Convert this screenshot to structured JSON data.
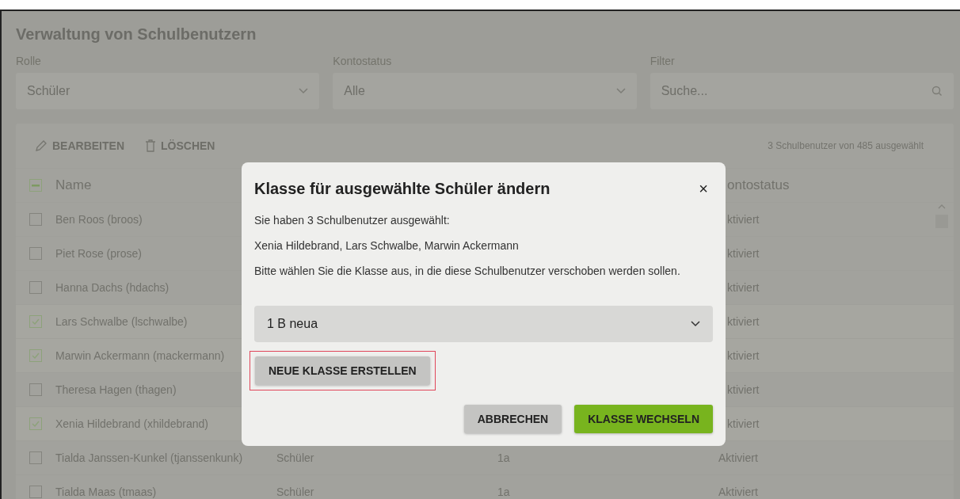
{
  "page": {
    "title": "Verwaltung von Schulbenutzern"
  },
  "filters": [
    {
      "kind": "select",
      "label": "Rolle",
      "value": "Schüler"
    },
    {
      "kind": "select",
      "label": "Kontostatus",
      "value": "Alle"
    },
    {
      "kind": "search",
      "label": "Filter",
      "placeholder": "Suche..."
    }
  ],
  "toolbar": {
    "actions": [
      {
        "kind": "edit",
        "label": "BEARBEITEN"
      },
      {
        "kind": "delete",
        "label": "LÖSCHEN"
      }
    ],
    "selection_info": "3 Schulbenutzer von 485 ausgewählt"
  },
  "table": {
    "select_all": {
      "indeterminate": true
    },
    "columns": [
      {
        "label": "Name"
      },
      {
        "label": "ontostatus"
      }
    ],
    "rows": [
      {
        "checked": false,
        "name": "Ben Roos (broos)",
        "status": "ktiviert"
      },
      {
        "checked": false,
        "name": "Piet Rose (prose)",
        "status": "ktiviert"
      },
      {
        "checked": false,
        "name": "Hanna Dachs (hdachs)",
        "status": "ktiviert"
      },
      {
        "checked": true,
        "name": "Lars Schwalbe (lschwalbe)",
        "status": "ktiviert"
      },
      {
        "checked": true,
        "name": "Marwin Ackermann (mackermann)",
        "status": "ktiviert"
      },
      {
        "checked": false,
        "name": "Theresa Hagen (thagen)",
        "status": "ktiviert"
      },
      {
        "checked": true,
        "name": "Xenia Hildebrand (xhildebrand)",
        "status": "ktiviert"
      },
      {
        "checked": false,
        "name": "Tialda Janssen-Kunkel (tjanssenkunk)",
        "role": "Schüler",
        "class": "1a",
        "status": "Aktiviert"
      },
      {
        "checked": false,
        "name": "Tialda Maas (tmaas)",
        "role": "Schüler",
        "class": "1a",
        "status": "Aktiviert"
      }
    ]
  },
  "dialog": {
    "title": "Klasse für ausgewählte Schüler ändern",
    "close": "×",
    "paragraphs": [
      "Sie haben 3 Schulbenutzer ausgewählt:",
      "Xenia Hildebrand, Lars Schwalbe, Marwin Ackermann",
      "Bitte wählen Sie die Klasse aus, in die diese Schulbenutzer verschoben werden sollen."
    ],
    "class_select": {
      "value": "1 B neua"
    },
    "create_button": {
      "label": "NEUE KLASSE ERSTELLEN",
      "highlighted": true
    },
    "buttons": [
      {
        "kind": "secondary",
        "label": "ABBRECHEN"
      },
      {
        "kind": "primary",
        "label": "KLASSE WECHSELN"
      }
    ]
  }
}
